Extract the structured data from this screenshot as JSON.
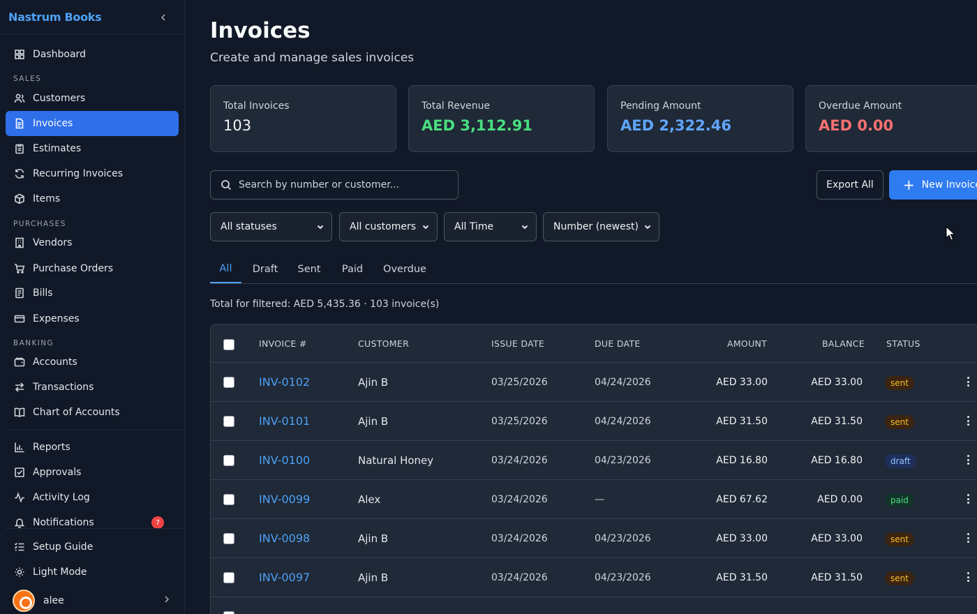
{
  "app": {
    "brand": "Nastrum Books"
  },
  "sidebar": {
    "items": {
      "dashboard": "Dashboard",
      "customers": "Customers",
      "invoices": "Invoices",
      "estimates": "Estimates",
      "recurring": "Recurring Invoices",
      "items": "Items",
      "vendors": "Vendors",
      "purchase_orders": "Purchase Orders",
      "bills": "Bills",
      "expenses": "Expenses",
      "accounts": "Accounts",
      "transactions": "Transactions",
      "chart_of_accounts": "Chart of Accounts",
      "reports": "Reports",
      "approvals": "Approvals",
      "activity_log": "Activity Log",
      "notifications": "Notifications",
      "setup_guide": "Setup Guide",
      "light_mode": "Light Mode"
    },
    "sections": {
      "sales": "SALES",
      "purchases": "PURCHASES",
      "banking": "BANKING"
    },
    "notifications_count": "7",
    "user": "alee",
    "active_color": "#2f6fe9"
  },
  "page": {
    "title": "Invoices",
    "subtitle": "Create and manage sales invoices"
  },
  "stats": [
    {
      "label": "Total Invoices",
      "value": "103",
      "color": "#f3f4f6"
    },
    {
      "label": "Total Revenue",
      "value": "AED 3,112.91",
      "color": "#4ade80"
    },
    {
      "label": "Pending Amount",
      "value": "AED 2,322.46",
      "color": "#60a5fa"
    },
    {
      "label": "Overdue Amount",
      "value": "AED 0.00",
      "color": "#f87171"
    }
  ],
  "search": {
    "placeholder": "Search by number or customer..."
  },
  "buttons": {
    "export": "Export All",
    "new_invoice": "New Invoice"
  },
  "filters": {
    "status": "All statuses",
    "customer": "All customers",
    "period": "All Time",
    "sort": "Number (newest)"
  },
  "tabs": [
    "All",
    "Draft",
    "Sent",
    "Paid",
    "Overdue"
  ],
  "active_tab": "All",
  "filtered_total": "Total for filtered: AED 5,435.36 · 103 invoice(s)",
  "table": {
    "headers": {
      "invoice": "INVOICE #",
      "customer": "CUSTOMER",
      "issue_date": "ISSUE DATE",
      "due_date": "DUE DATE",
      "amount": "AMOUNT",
      "balance": "BALANCE",
      "status": "STATUS"
    },
    "rows": [
      {
        "invoice": "INV-0102",
        "customer": "Ajin B",
        "issue": "03/25/2026",
        "due": "04/24/2026",
        "amount": "AED 33.00",
        "balance": "AED 33.00",
        "status": "sent"
      },
      {
        "invoice": "INV-0101",
        "customer": "Ajin B",
        "issue": "03/25/2026",
        "due": "04/24/2026",
        "amount": "AED 31.50",
        "balance": "AED 31.50",
        "status": "sent"
      },
      {
        "invoice": "INV-0100",
        "customer": "Natural Honey",
        "issue": "03/24/2026",
        "due": "04/23/2026",
        "amount": "AED 16.80",
        "balance": "AED 16.80",
        "status": "draft"
      },
      {
        "invoice": "INV-0099",
        "customer": "Alex",
        "issue": "03/24/2026",
        "due": "—",
        "amount": "AED 67.62",
        "balance": "AED 0.00",
        "status": "paid"
      },
      {
        "invoice": "INV-0098",
        "customer": "Ajin B",
        "issue": "03/24/2026",
        "due": "04/23/2026",
        "amount": "AED 33.00",
        "balance": "AED 33.00",
        "status": "sent"
      },
      {
        "invoice": "INV-0097",
        "customer": "Ajin B",
        "issue": "03/24/2026",
        "due": "04/23/2026",
        "amount": "AED 31.50",
        "balance": "AED 31.50",
        "status": "sent"
      }
    ]
  }
}
